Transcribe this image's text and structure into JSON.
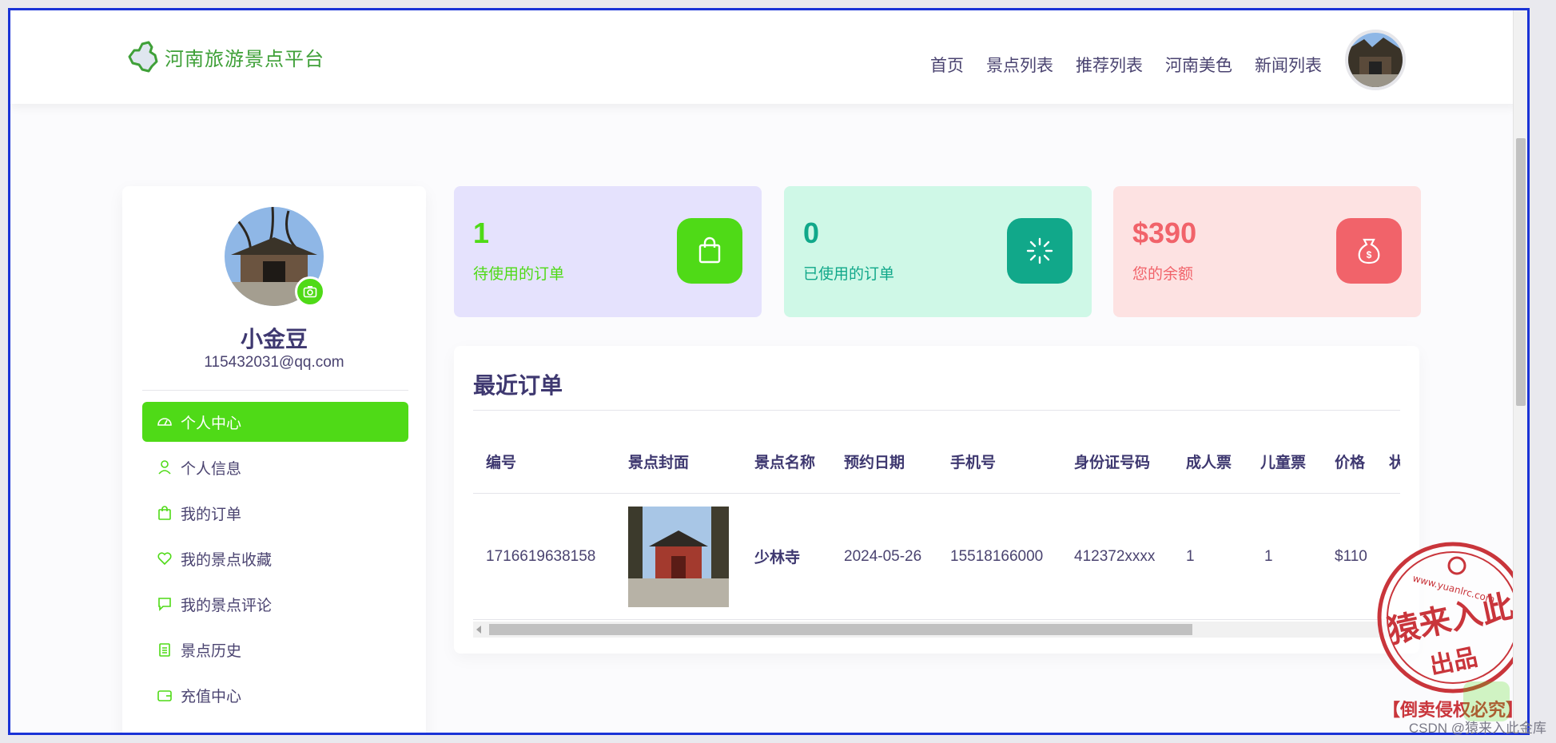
{
  "brand": {
    "name": "河南旅游景点平台"
  },
  "nav": {
    "items": [
      "首页",
      "景点列表",
      "推荐列表",
      "河南美色",
      "新闻列表"
    ]
  },
  "user": {
    "name": "小金豆",
    "email": "115432031@qq.com"
  },
  "sidebar": {
    "items": [
      {
        "label": "个人中心",
        "icon": "dashboard-icon",
        "active": true
      },
      {
        "label": "个人信息",
        "icon": "user-icon"
      },
      {
        "label": "我的订单",
        "icon": "bag-icon"
      },
      {
        "label": "我的景点收藏",
        "icon": "heart-icon"
      },
      {
        "label": "我的景点评论",
        "icon": "comment-icon"
      },
      {
        "label": "景点历史",
        "icon": "clipboard-icon"
      },
      {
        "label": "充值中心",
        "icon": "wallet-icon"
      }
    ]
  },
  "stats": [
    {
      "value": "1",
      "label": "待使用的订单",
      "icon": "shopping-bag-icon",
      "color": "#4fda17"
    },
    {
      "value": "0",
      "label": "已使用的订单",
      "icon": "loader-icon",
      "color": "#11a88a"
    },
    {
      "value": "$390",
      "label": "您的余额",
      "icon": "money-bag-icon",
      "color": "#f1636a"
    }
  ],
  "orders": {
    "title": "最近订单",
    "headers": [
      "编号",
      "景点封面",
      "景点名称",
      "预约日期",
      "手机号",
      "身份证号码",
      "成人票",
      "儿童票",
      "价格",
      "状"
    ],
    "rows": [
      {
        "id": "1716619638158",
        "name": "少林寺",
        "date": "2024-05-26",
        "phone": "15518166000",
        "idcard": "412372xxxx",
        "adult": "1",
        "child": "1",
        "price": "$110"
      }
    ]
  },
  "stamp": {
    "text": "猿来入此",
    "sub": "出品",
    "url": "www.yuanlrc.com",
    "footer": "【倒卖侵权必究】"
  },
  "watermark": "CSDN @猿来入此金库"
}
